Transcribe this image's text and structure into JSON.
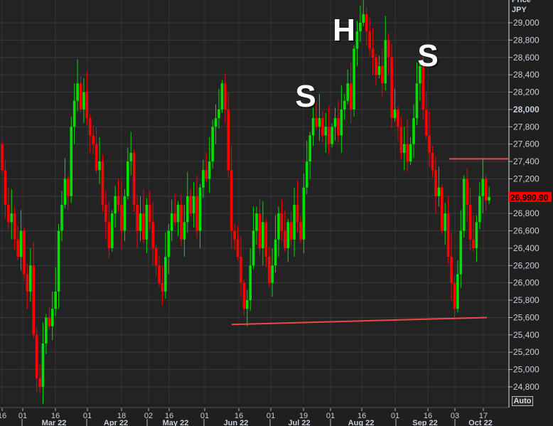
{
  "chart_data": {
    "type": "candlestick",
    "title": "",
    "ylabel_line1": "Price",
    "ylabel_line2": "JPY",
    "ylim": [
      24600,
      29200
    ],
    "yticks": [
      24800,
      25000,
      25200,
      25400,
      25600,
      25800,
      26000,
      26200,
      26400,
      26600,
      26800,
      27000,
      27200,
      27400,
      27600,
      27800,
      28000,
      28200,
      28400,
      28600,
      28800,
      29000
    ],
    "ytick_labels": [
      "24,800",
      "25,000",
      "25,200",
      "25,400",
      "25,600",
      "25,800",
      "26,000",
      "26,200",
      "26,400",
      "26,600",
      "26,800",
      "27,000",
      "27,200",
      "27,400",
      "27,600",
      "27,800",
      "28,000",
      "28,200",
      "28,400",
      "28,600",
      "28,800",
      "29,000"
    ],
    "emphasized_tick": "28,000",
    "last_price": 26990.9,
    "last_price_label": "26,990.90",
    "x_day_ticks": [
      "16",
      "01",
      "16",
      "01",
      "18",
      "02",
      "16",
      "01",
      "16",
      "01",
      "19",
      "01",
      "16",
      "01",
      "16",
      "03",
      "17"
    ],
    "x_month_labels": [
      "Mar 22",
      "Apr 22",
      "May 22",
      "Jun 22",
      "Jul 22",
      "Aug 22",
      "Sep 22",
      "Oct 22"
    ],
    "closes": [
      27300,
      26900,
      26700,
      26800,
      26500,
      26300,
      26600,
      26100,
      25900,
      26200,
      25400,
      24900,
      24800,
      25300,
      25600,
      25500,
      25700,
      25900,
      26600,
      26900,
      27200,
      27000,
      27800,
      28100,
      28300,
      28000,
      28200,
      27900,
      27700,
      27600,
      27300,
      27400,
      26900,
      26700,
      26400,
      26800,
      27000,
      26900,
      26600,
      27000,
      27400,
      27500,
      26900,
      26600,
      26800,
      26500,
      26900,
      26700,
      26400,
      26200,
      26000,
      25900,
      26300,
      26600,
      26800,
      26700,
      26900,
      26500,
      26700,
      27000,
      26800,
      27000,
      26600,
      27100,
      27300,
      27200,
      27400,
      27800,
      27900,
      28000,
      28300,
      28000,
      27300,
      26600,
      26500,
      26300,
      26000,
      25700,
      25800,
      26200,
      26600,
      26800,
      26400,
      26700,
      26300,
      26000,
      26200,
      26500,
      26800,
      26600,
      26400,
      26700,
      26500,
      26900,
      26700,
      26500,
      27100,
      27400,
      27700,
      27900,
      27800,
      27900,
      27700,
      27800,
      27600,
      27800,
      27900,
      27700,
      28000,
      28100,
      28300,
      28000,
      28700,
      28900,
      29000,
      29100,
      28900,
      28700,
      28600,
      28400,
      28500,
      28300,
      28800,
      28600,
      27900,
      28000,
      27800,
      27500,
      27600,
      27400,
      27600,
      27900,
      28300,
      28500,
      28000,
      27700,
      27500,
      27300,
      27000,
      27100,
      26600,
      26800,
      26300,
      26000,
      25700,
      26100,
      26600,
      27200,
      26900,
      26500,
      26400,
      26700,
      27000,
      27200,
      26950,
      26990.9
    ],
    "first_open": 27600,
    "colors": {
      "up": "#00e000",
      "down": "#ff0000",
      "trendline": "#f04848",
      "price_tag": "#ff0000"
    },
    "annotations": [
      {
        "text": "S",
        "label": "left shoulder"
      },
      {
        "text": "H",
        "label": "head"
      },
      {
        "text": "S",
        "label": "right shoulder"
      }
    ],
    "trendlines": [
      {
        "name": "support",
        "from": 25520,
        "to": 25600
      },
      {
        "name": "neckline",
        "from": 27430,
        "to": 27430
      }
    ]
  },
  "controls": {
    "auto_label": "Auto"
  }
}
